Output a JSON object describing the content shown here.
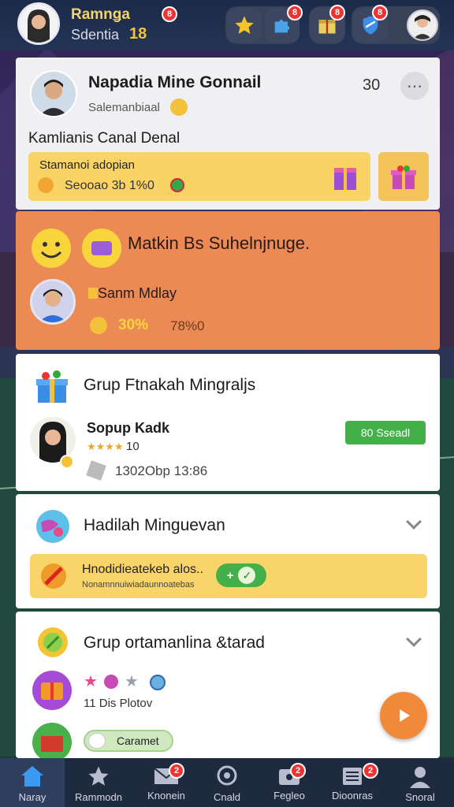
{
  "header": {
    "user_name": "Ramnǥa",
    "user_sub": "Sdentia",
    "level": "18",
    "badges": {
      "profile": "8",
      "puzzle": "8",
      "gift": "8",
      "shield": "8"
    }
  },
  "card_profile": {
    "name": "Napadia Mine Gonnail",
    "subtitle": "Salemanbiaal",
    "count": "30",
    "channel": "Kamlianis Canal Denal",
    "promo_title": "Stamanoi adopian",
    "promo_sub": "Seooao 3b 1%0"
  },
  "card_orange": {
    "title": "Matkin Bs Suhelnjnuge.",
    "user": "Sanm Mdlay",
    "percent": "30%",
    "value": "78%0"
  },
  "card_group": {
    "title": "Grup Ftnakah Mingraljs",
    "member": "Sopup Kadk",
    "rating": "10",
    "meta": "1302Obp 13:86",
    "button": "80 Sseadl"
  },
  "card_reward": {
    "title": "Hadilah Minguevan",
    "banner_title": "Hnodidieatekeb alos..",
    "banner_sub": "Nonamnnuiwiadaunnoatebas"
  },
  "card_group2": {
    "title": "Grup ortamanlina &tarad",
    "stats": "11 Dis  Plotov",
    "tag": "Caramet"
  },
  "nav": {
    "items": [
      {
        "label": "Naray"
      },
      {
        "label": "Rammodn"
      },
      {
        "label": "Knonein"
      },
      {
        "label": "Cnald"
      },
      {
        "label": "Fegleo"
      },
      {
        "label": "Dioonras"
      },
      {
        "label": "Snoral"
      }
    ],
    "badge_mail": "2",
    "badge_game": "2",
    "badge_list": "2"
  },
  "colors": {
    "accent_orange": "#ec8a55",
    "accent_green": "#44b04a",
    "nav_bg": "#1e2a40"
  }
}
